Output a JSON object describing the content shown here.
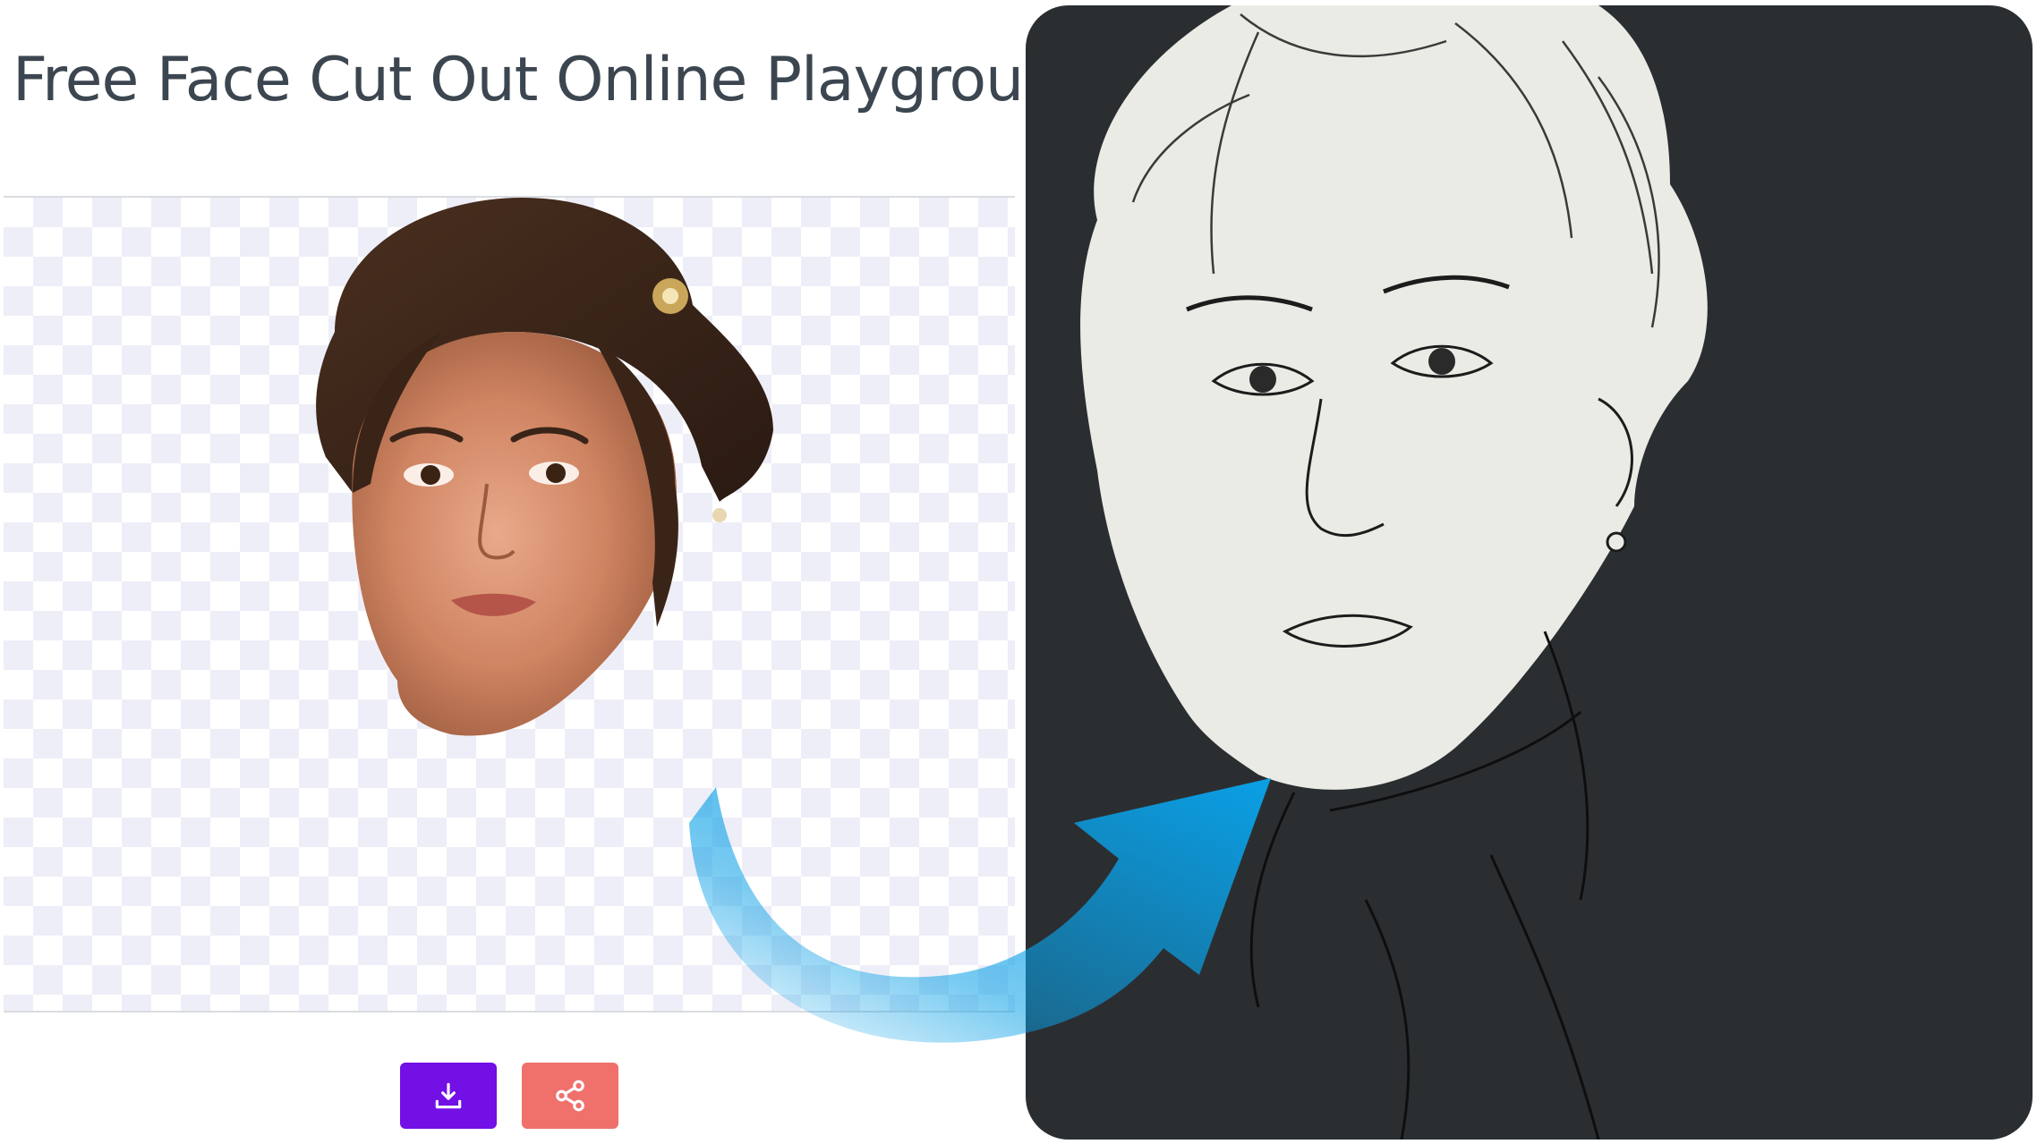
{
  "header": {
    "title": "Free Face Cut Out Online Playground"
  },
  "result": {
    "image_icon": "face-cutout-image"
  },
  "actions": {
    "download_icon": "download-icon",
    "share_icon": "share-icon",
    "download_color": "#7210e6",
    "share_color": "#f0706c"
  },
  "showcase": {
    "sketch_icon": "ink-sketch-portrait",
    "arrow_icon": "curved-arrow-icon",
    "arrow_color": "#0aa0e6",
    "panel_color": "#2b2e31"
  }
}
